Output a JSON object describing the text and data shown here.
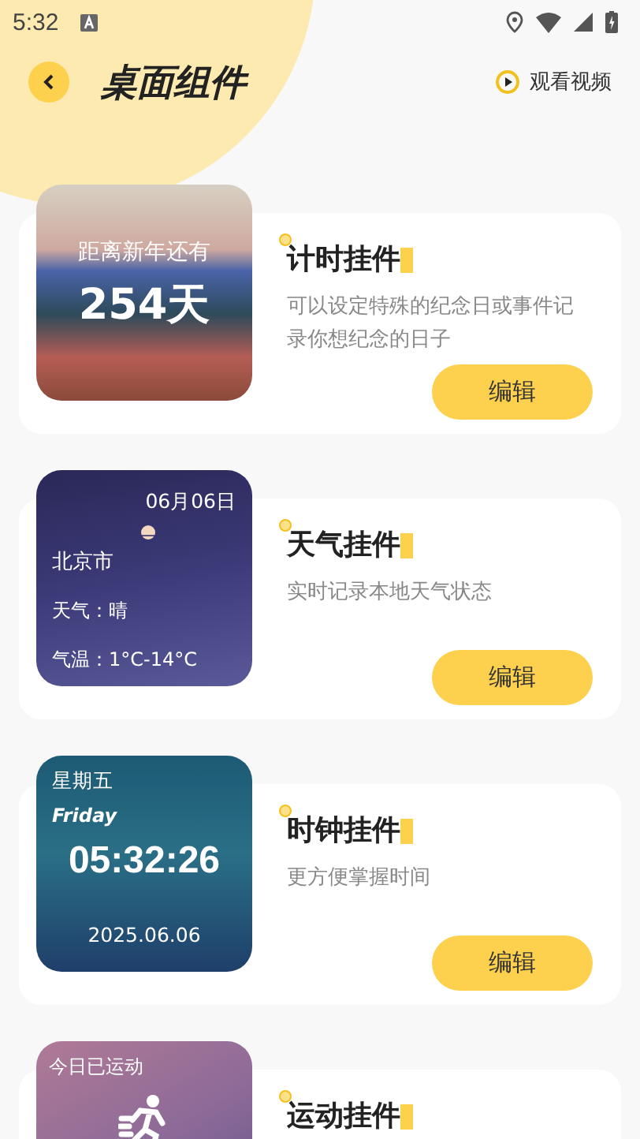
{
  "status_bar": {
    "time": "5:32"
  },
  "header": {
    "title": "桌面组件",
    "video_link": "观看视频"
  },
  "widgets": [
    {
      "kind": "countdown",
      "title": "计时挂件",
      "description": "可以设定特殊的纪念日或事件记录你想纪念的日子",
      "button": "编辑",
      "preview": {
        "label": "距离新年还有",
        "value": "254天"
      }
    },
    {
      "kind": "weather",
      "title": "天气挂件",
      "description": "实时记录本地天气状态",
      "button": "编辑",
      "preview": {
        "date": "06月06日",
        "city": "北京市",
        "weather": "天气：晴",
        "temperature": "气温：1°C-14°C"
      }
    },
    {
      "kind": "clock",
      "title": "时钟挂件",
      "description": "更方便掌握时间",
      "button": "编辑",
      "preview": {
        "weekday": "星期五",
        "weekday_en": "Friday",
        "time": "05:32:26",
        "date": "2025.06.06"
      }
    },
    {
      "kind": "sport",
      "title": "运动挂件",
      "preview": {
        "label": "今日已运动"
      }
    }
  ]
}
